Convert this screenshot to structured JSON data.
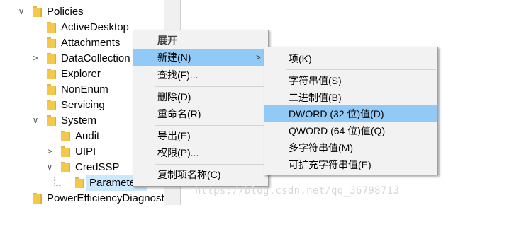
{
  "tree": {
    "rows": [
      {
        "label": "Policies",
        "chevron": "∨"
      },
      {
        "label": "ActiveDesktop",
        "chevron": ""
      },
      {
        "label": "Attachments",
        "chevron": ""
      },
      {
        "label": "DataCollection",
        "chevron": ">"
      },
      {
        "label": "Explorer",
        "chevron": ""
      },
      {
        "label": "NonEnum",
        "chevron": ""
      },
      {
        "label": "Servicing",
        "chevron": ""
      },
      {
        "label": "System",
        "chevron": "∨"
      },
      {
        "label": "Audit",
        "chevron": ""
      },
      {
        "label": "UIPI",
        "chevron": ">"
      },
      {
        "label": "CredSSP",
        "chevron": "∨"
      },
      {
        "label": "Parameters",
        "chevron": ""
      },
      {
        "label": "PowerEfficiencyDiagnostics",
        "chevron": ""
      }
    ]
  },
  "context_menu": {
    "header": "展开",
    "items": [
      {
        "label": "新建(N)",
        "submenu_arrow": ">"
      },
      {
        "label": "查找(F)..."
      },
      {
        "label": "删除(D)"
      },
      {
        "label": "重命名(R)"
      },
      {
        "label": "导出(E)"
      },
      {
        "label": "权限(P)..."
      },
      {
        "label": "复制项名称(C)"
      }
    ]
  },
  "submenu": {
    "items": [
      {
        "label": "项(K)"
      },
      {
        "label": "字符串值(S)"
      },
      {
        "label": "二进制值(B)"
      },
      {
        "label": "DWORD (32 位)值(D)"
      },
      {
        "label": "QWORD (64 位)值(Q)"
      },
      {
        "label": "多字符串值(M)"
      },
      {
        "label": "可扩充字符串值(E)"
      }
    ]
  },
  "watermark": "https://blog.csdn.net/qq_36798713",
  "colors": {
    "highlight": "#91c9f7",
    "selected": "#cce8ff",
    "folder": "#f4c84b",
    "menu_bg": "#f2f2f2"
  }
}
